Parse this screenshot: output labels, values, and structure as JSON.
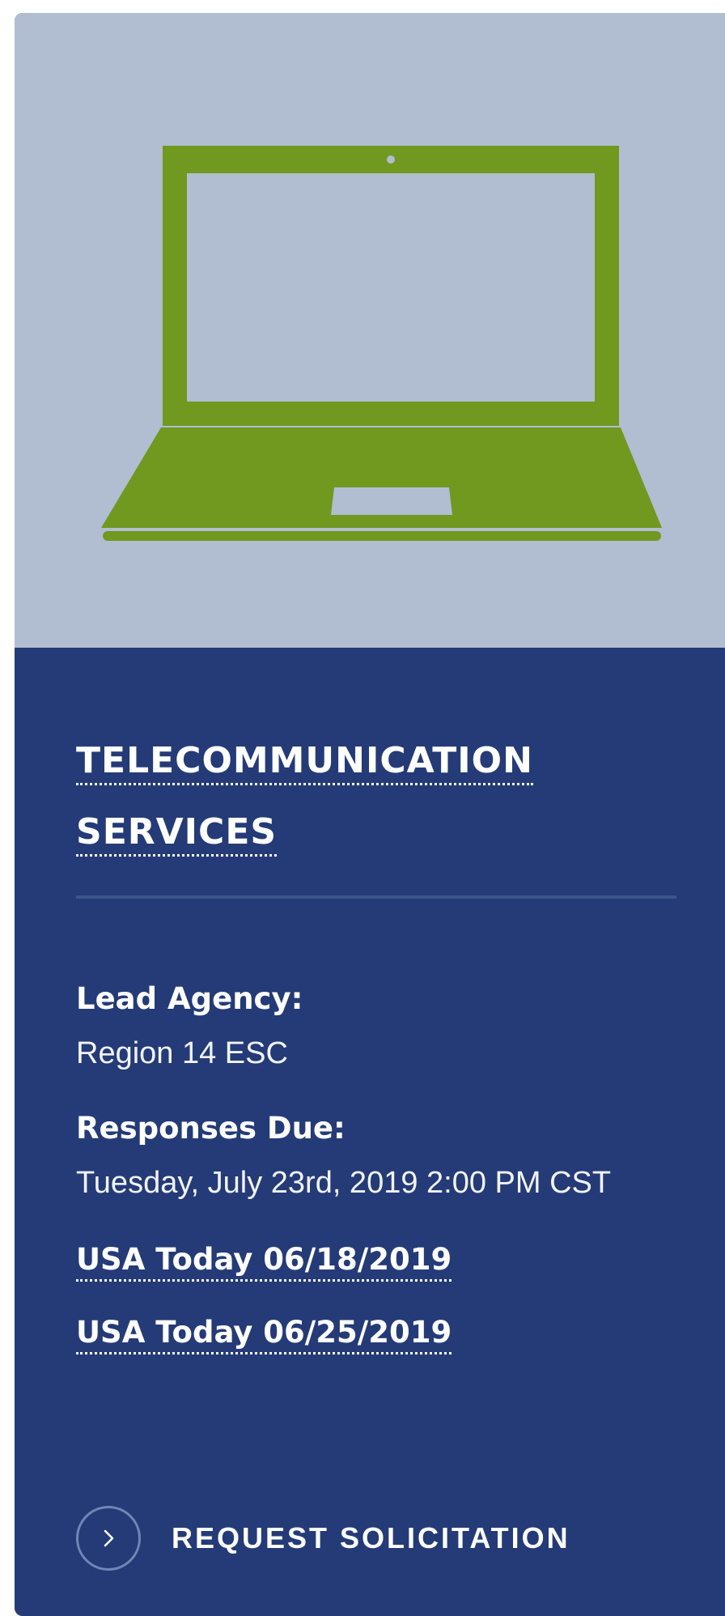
{
  "card": {
    "hero_icon": "laptop-icon",
    "hero_color": "#b1bdd1",
    "icon_color": "#71981f",
    "body_color": "#243b77",
    "title_lines": [
      "TELECOMMUNICATION",
      "SERVICES"
    ],
    "details": [
      {
        "label": "Lead Agency:",
        "value": "Region 14 ESC"
      },
      {
        "label": "Responses Due:",
        "value": "Tuesday, July 23rd, 2019 2:00 PM CST"
      }
    ],
    "links": [
      "USA Today 06/18/2019",
      "USA Today 06/25/2019"
    ],
    "cta": {
      "label": "REQUEST SOLICITATION",
      "icon": "chevron-right-icon"
    }
  }
}
